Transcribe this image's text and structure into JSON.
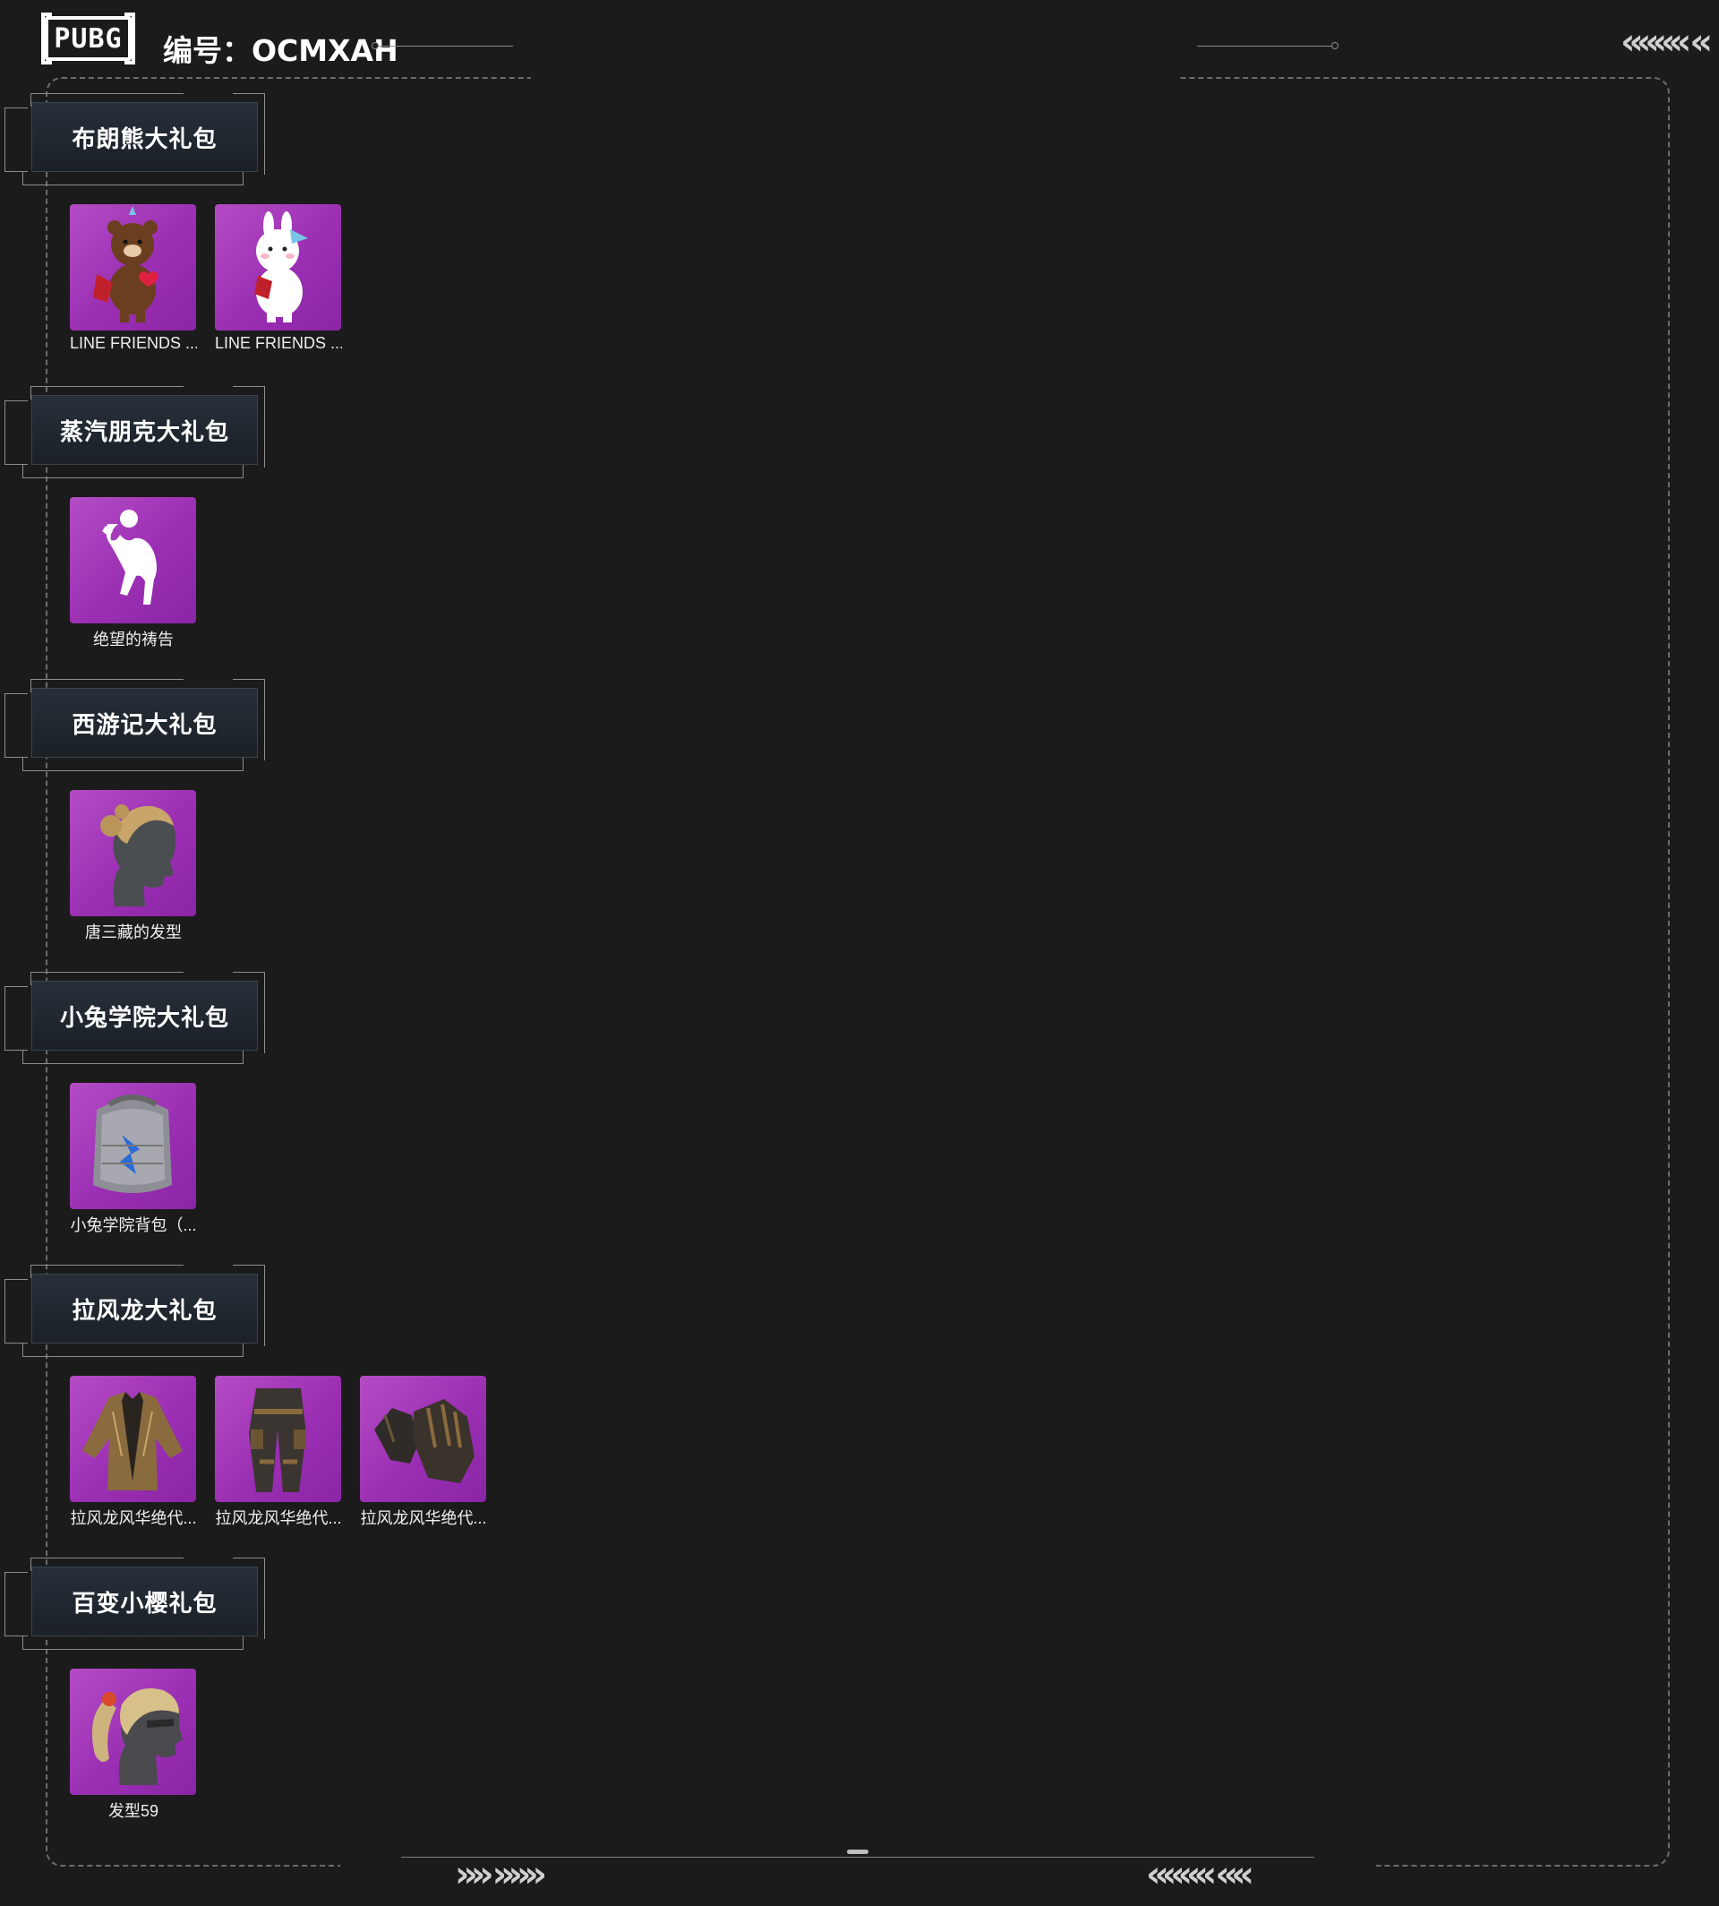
{
  "header": {
    "logo_text": "PUBG",
    "id_label": "编号：OCMXAH"
  },
  "footer": {
    "chevrons_right": "»» »»»",
    "chevrons_left": "«««« ««"
  },
  "top_right_chevrons": "«««« «",
  "sections": [
    {
      "title": "布朗熊大礼包",
      "items": [
        {
          "name": "LINE FRIENDS ...",
          "icon": "brown-bear-icon"
        },
        {
          "name": "LINE FRIENDS ...",
          "icon": "cony-bunny-icon"
        }
      ]
    },
    {
      "title": "蒸汽朋克大礼包",
      "items": [
        {
          "name": "绝望的祷告",
          "icon": "emote-pose-icon"
        }
      ]
    },
    {
      "title": "西游记大礼包",
      "items": [
        {
          "name": "唐三藏的发型",
          "icon": "hairstyle-icon"
        }
      ]
    },
    {
      "title": "小兔学院大礼包",
      "items": [
        {
          "name": "小兔学院背包（...",
          "icon": "backpack-icon"
        }
      ]
    },
    {
      "title": "拉风龙大礼包",
      "items": [
        {
          "name": "拉风龙风华绝代...",
          "icon": "jacket-icon"
        },
        {
          "name": "拉风龙风华绝代...",
          "icon": "pants-icon"
        },
        {
          "name": "拉风龙风华绝代...",
          "icon": "gloves-icon"
        }
      ]
    },
    {
      "title": "百变小樱礼包",
      "items": [
        {
          "name": "发型59",
          "icon": "ponytail-hairstyle-icon"
        }
      ]
    }
  ]
}
